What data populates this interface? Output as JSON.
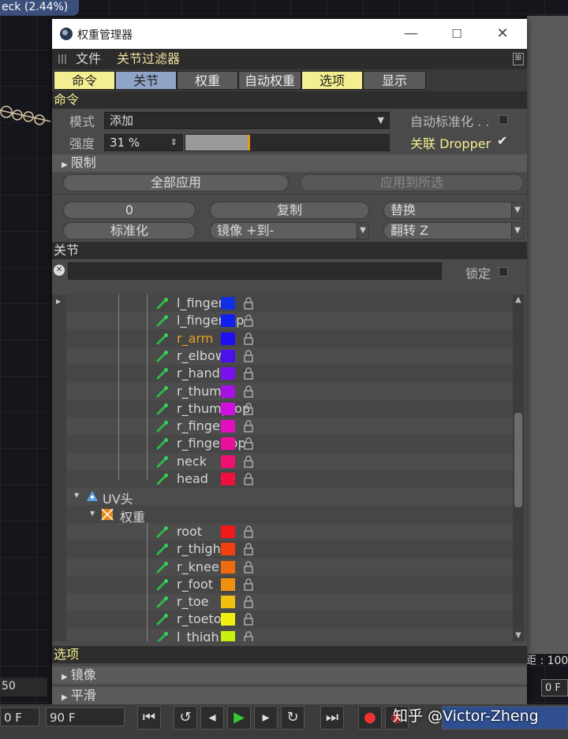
{
  "viewport": {
    "title": "eck (2.44%)",
    "distance_label": "距 : 100",
    "left_field": "50",
    "right_field": "0 F"
  },
  "window": {
    "title": "权重管理器",
    "controls": {
      "minimize": "—",
      "maximize": "☐",
      "close": "✕"
    }
  },
  "menu": {
    "file": "文件",
    "joint_filter": "关节过滤器"
  },
  "tabs": [
    {
      "label": "命令",
      "style": "yellow"
    },
    {
      "label": "关节",
      "style": "blue"
    },
    {
      "label": "权重",
      "style": "dark"
    },
    {
      "label": "自动权重",
      "style": "dark"
    },
    {
      "label": "选项",
      "style": "yellow"
    },
    {
      "label": "显示",
      "style": "dark"
    }
  ],
  "command": {
    "header": "命令",
    "mode_label": "模式",
    "mode_value": "添加",
    "auto_normalize_label": "自动标准化 . .",
    "strength_label": "强度",
    "strength_value": "31 %",
    "strength_fraction": 0.31,
    "dropper_label": "关联 Dropper",
    "dropper_check": "✔",
    "limit_label": "限制",
    "apply_all": "全部应用",
    "apply_selected": "应用到所选",
    "zero_btn": "0",
    "copy_btn": "复制",
    "replace_dd": "替换",
    "normalize_btn": "标准化",
    "mirror_dd": "镜像 +到-",
    "flip_dd": "翻转 Z"
  },
  "joints": {
    "header": "关节",
    "lock_label": "锁定",
    "clear_icon": "✕",
    "rows": [
      {
        "name": "l_finger",
        "color": "#1030e8"
      },
      {
        "name": "l_fingertop",
        "color": "#1020f0"
      },
      {
        "name": "r_arm",
        "color": "#2010f0",
        "selected": true
      },
      {
        "name": "r_elbow",
        "color": "#4a10ee"
      },
      {
        "name": "r_hand",
        "color": "#7a10ec"
      },
      {
        "name": "r_thump",
        "color": "#a810e8"
      },
      {
        "name": "r_thumptop",
        "color": "#d010e0"
      },
      {
        "name": "r_finger",
        "color": "#e010c0"
      },
      {
        "name": "r_fingertop",
        "color": "#e8109a"
      },
      {
        "name": "neck",
        "color": "#ee1070"
      },
      {
        "name": "head",
        "color": "#f01040"
      }
    ],
    "uv_group": "UV头",
    "weight_tag": "权重",
    "rows2": [
      {
        "name": "root",
        "color": "#f01818"
      },
      {
        "name": "r_thigh",
        "color": "#f04010"
      },
      {
        "name": "r_knee",
        "color": "#f06a10"
      },
      {
        "name": "r_foot",
        "color": "#f09010"
      },
      {
        "name": "r_toe",
        "color": "#f0c010"
      },
      {
        "name": "r_toetop",
        "color": "#f0f010"
      },
      {
        "name": "l_thigh",
        "color": "#c8f010"
      }
    ]
  },
  "options": {
    "header": "选项",
    "mirror": "镜像",
    "smooth": "平滑"
  },
  "timeline": {
    "start_field": "0 F",
    "end_field": "90 F"
  },
  "watermark": "知乎 @Victor-Zheng"
}
